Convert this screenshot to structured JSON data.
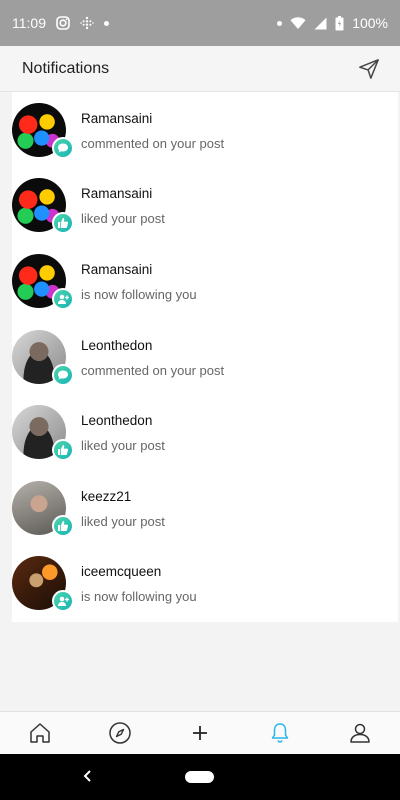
{
  "status_bar": {
    "time": "11:09",
    "battery": "100%"
  },
  "header": {
    "title": "Notifications",
    "send_icon": "send-icon"
  },
  "notifications": [
    {
      "username": "Ramansaini",
      "action": "commented on your post",
      "type": "comment",
      "avatar": "paint"
    },
    {
      "username": "Ramansaini",
      "action": "liked your post",
      "type": "like",
      "avatar": "paint"
    },
    {
      "username": "Ramansaini",
      "action": "is now following you",
      "type": "follow",
      "avatar": "paint"
    },
    {
      "username": "Leonthedon",
      "action": "commented on your post",
      "type": "comment",
      "avatar": "mono"
    },
    {
      "username": "Leonthedon",
      "action": "liked your post",
      "type": "like",
      "avatar": "mono"
    },
    {
      "username": "keezz21",
      "action": "liked your post",
      "type": "like",
      "avatar": "keez"
    },
    {
      "username": "iceemcqueen",
      "action": "is now following you",
      "type": "follow",
      "avatar": "ice"
    }
  ],
  "bottom_nav": [
    {
      "name": "home-icon",
      "active": false
    },
    {
      "name": "compass-icon",
      "active": false
    },
    {
      "name": "plus-icon",
      "active": false
    },
    {
      "name": "bell-icon",
      "active": true
    },
    {
      "name": "profile-icon",
      "active": false
    }
  ],
  "colors": {
    "accent": "#29b6e8",
    "badge_start": "#4dd6a8",
    "badge_end": "#19b3b8"
  }
}
